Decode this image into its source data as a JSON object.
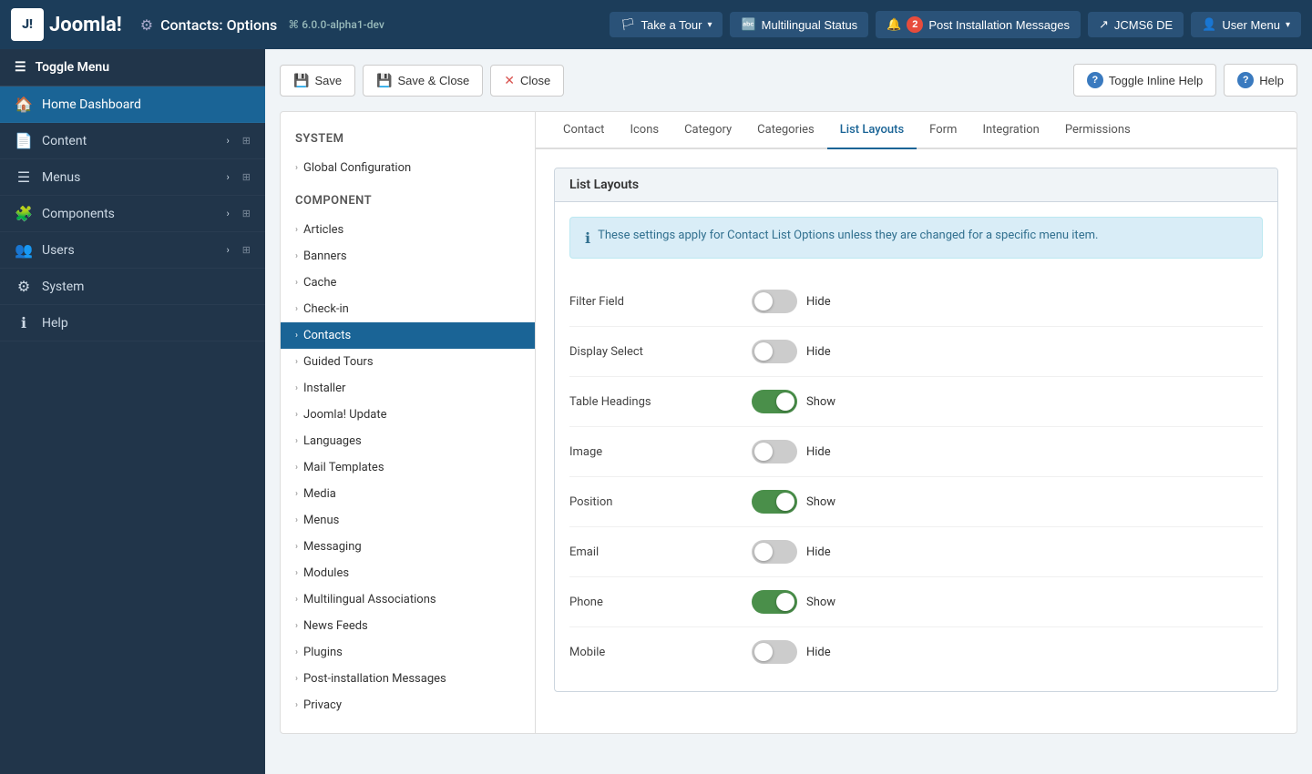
{
  "navbar": {
    "brand": "Joomla!",
    "logo_text": "J!",
    "page_title": "Contacts: Options",
    "gear_icon": "⚙",
    "version": "⌘ 6.0.0-alpha1-dev",
    "buttons": {
      "tour": {
        "label": "Take a Tour",
        "icon": "🏳"
      },
      "multilingual": {
        "label": "Multilingual Status",
        "icon": "🔤"
      },
      "post_install": {
        "label": "Post Installation Messages",
        "icon": "🔔",
        "badge": "2"
      },
      "jcms": {
        "label": "JCMS6 DE",
        "icon": "↗"
      },
      "user_menu": {
        "label": "User Menu",
        "icon": "👤"
      }
    }
  },
  "sidebar": {
    "toggle_label": "Toggle Menu",
    "items": [
      {
        "id": "home-dashboard",
        "label": "Home Dashboard",
        "icon": "🏠",
        "arrow": false
      },
      {
        "id": "content",
        "label": "Content",
        "icon": "📄",
        "arrow": true
      },
      {
        "id": "menus",
        "label": "Menus",
        "icon": "☰",
        "arrow": true
      },
      {
        "id": "components",
        "label": "Components",
        "icon": "🧩",
        "arrow": true
      },
      {
        "id": "users",
        "label": "Users",
        "icon": "👥",
        "arrow": true
      },
      {
        "id": "system",
        "label": "System",
        "icon": "⚙",
        "arrow": false
      },
      {
        "id": "help",
        "label": "Help",
        "icon": "ℹ",
        "arrow": false
      }
    ]
  },
  "toolbar": {
    "save_label": "Save",
    "save_close_label": "Save & Close",
    "close_label": "Close",
    "toggle_inline_help_label": "Toggle Inline Help",
    "help_label": "Help"
  },
  "left_panel": {
    "system_title": "System",
    "system_items": [
      {
        "id": "global-config",
        "label": "Global Configuration",
        "active": false
      }
    ],
    "component_title": "Component",
    "component_items": [
      {
        "id": "articles",
        "label": "Articles",
        "active": false
      },
      {
        "id": "banners",
        "label": "Banners",
        "active": false
      },
      {
        "id": "cache",
        "label": "Cache",
        "active": false
      },
      {
        "id": "check-in",
        "label": "Check-in",
        "active": false
      },
      {
        "id": "contacts",
        "label": "Contacts",
        "active": true
      },
      {
        "id": "guided-tours",
        "label": "Guided Tours",
        "active": false
      },
      {
        "id": "installer",
        "label": "Installer",
        "active": false
      },
      {
        "id": "joomla-update",
        "label": "Joomla! Update",
        "active": false
      },
      {
        "id": "languages",
        "label": "Languages",
        "active": false
      },
      {
        "id": "mail-templates",
        "label": "Mail Templates",
        "active": false
      },
      {
        "id": "media",
        "label": "Media",
        "active": false
      },
      {
        "id": "menus",
        "label": "Menus",
        "active": false
      },
      {
        "id": "messaging",
        "label": "Messaging",
        "active": false
      },
      {
        "id": "modules",
        "label": "Modules",
        "active": false
      },
      {
        "id": "multilingual-associations",
        "label": "Multilingual Associations",
        "active": false
      },
      {
        "id": "news-feeds",
        "label": "News Feeds",
        "active": false
      },
      {
        "id": "plugins",
        "label": "Plugins",
        "active": false
      },
      {
        "id": "post-installation-messages",
        "label": "Post-installation Messages",
        "active": false
      },
      {
        "id": "privacy",
        "label": "Privacy",
        "active": false
      }
    ]
  },
  "tabs": [
    {
      "id": "contact",
      "label": "Contact",
      "active": false
    },
    {
      "id": "icons",
      "label": "Icons",
      "active": false
    },
    {
      "id": "category",
      "label": "Category",
      "active": false
    },
    {
      "id": "categories",
      "label": "Categories",
      "active": false
    },
    {
      "id": "list-layouts",
      "label": "List Layouts",
      "active": true
    },
    {
      "id": "form",
      "label": "Form",
      "active": false
    },
    {
      "id": "integration",
      "label": "Integration",
      "active": false
    },
    {
      "id": "permissions",
      "label": "Permissions",
      "active": false
    }
  ],
  "list_layouts": {
    "panel_title": "List Layouts",
    "info_text": "These settings apply for Contact List Options unless they are changed for a specific menu item.",
    "fields": [
      {
        "id": "filter-field",
        "label": "Filter Field",
        "state": "off",
        "value_label": "Hide"
      },
      {
        "id": "display-select",
        "label": "Display Select",
        "state": "off",
        "value_label": "Hide"
      },
      {
        "id": "table-headings",
        "label": "Table Headings",
        "state": "on",
        "value_label": "Show"
      },
      {
        "id": "image",
        "label": "Image",
        "state": "off",
        "value_label": "Hide"
      },
      {
        "id": "position",
        "label": "Position",
        "state": "on",
        "value_label": "Show"
      },
      {
        "id": "email",
        "label": "Email",
        "state": "off",
        "value_label": "Hide"
      },
      {
        "id": "phone",
        "label": "Phone",
        "state": "on",
        "value_label": "Show"
      },
      {
        "id": "mobile",
        "label": "Mobile",
        "state": "off",
        "value_label": "Hide"
      }
    ]
  }
}
